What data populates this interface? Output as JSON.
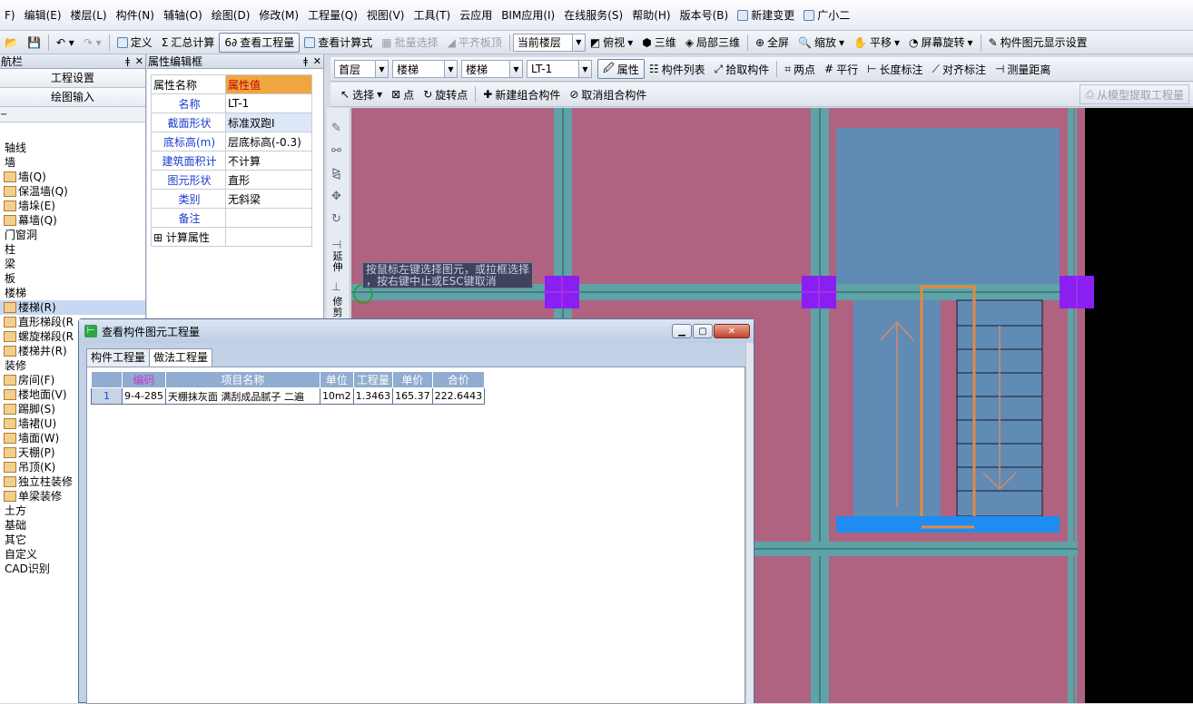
{
  "menu": [
    "F)",
    "编辑(E)",
    "楼层(L)",
    "构件(N)",
    "辅轴(O)",
    "绘图(D)",
    "修改(M)",
    "工程量(Q)",
    "视图(V)",
    "工具(T)",
    "云应用",
    "BIM应用(I)",
    "在线服务(S)",
    "帮助(H)",
    "版本号(B)",
    "新建变更",
    "广小二"
  ],
  "toolbar1": {
    "define": "定义",
    "summary": "汇总计算",
    "view_quantity": "查看工程量",
    "view_formula": "查看计算式",
    "batch_select": "批量选择",
    "align_slab": "平齐板顶",
    "floor_select": "当前楼层",
    "top_view": "俯视",
    "three_d": "三维",
    "local_3d": "局部三维",
    "fullscreen": "全屏",
    "zoom": "缩放",
    "pan": "平移",
    "rotate": "屏幕旋转",
    "display_settings": "构件图元显示设置"
  },
  "toolbar2": {
    "floor": "首层",
    "category": "楼梯",
    "type": "楼梯",
    "component": "LT-1",
    "property": "属性",
    "component_list": "构件列表",
    "pick": "拾取构件",
    "two_points": "两点",
    "parallel": "平行",
    "length_dim": "长度标注",
    "align_dim": "对齐标注",
    "measure": "测量距离"
  },
  "toolbar3": {
    "select": "选择",
    "point": "点",
    "rotate_point": "旋转点",
    "new_group": "新建组合构件",
    "cancel_group": "取消组合构件",
    "extract": "从模型提取工程量"
  },
  "left_panel": {
    "title": "航栏",
    "project_settings": "工程设置",
    "drawing_input": "绘图输入",
    "tree": [
      {
        "label": "轴线",
        "icon": false,
        "indent": 0
      },
      {
        "label": "墙",
        "icon": false,
        "indent": 0
      },
      {
        "label": "墙(Q)",
        "icon": true,
        "indent": 1
      },
      {
        "label": "保温墙(Q)",
        "icon": true,
        "indent": 1
      },
      {
        "label": "墙垛(E)",
        "icon": true,
        "indent": 1
      },
      {
        "label": "幕墙(Q)",
        "icon": true,
        "indent": 1
      },
      {
        "label": "门窗洞",
        "icon": false,
        "indent": 0
      },
      {
        "label": "柱",
        "icon": false,
        "indent": 0
      },
      {
        "label": "梁",
        "icon": false,
        "indent": 0
      },
      {
        "label": "板",
        "icon": false,
        "indent": 0
      },
      {
        "label": "楼梯",
        "icon": false,
        "indent": 0
      },
      {
        "label": "楼梯(R)",
        "icon": true,
        "indent": 1,
        "selected": true
      },
      {
        "label": "直形梯段(R",
        "icon": true,
        "indent": 1
      },
      {
        "label": "螺旋梯段(R",
        "icon": true,
        "indent": 1
      },
      {
        "label": "楼梯井(R)",
        "icon": true,
        "indent": 1
      },
      {
        "label": "装修",
        "icon": false,
        "indent": 0
      },
      {
        "label": "房间(F)",
        "icon": true,
        "indent": 1
      },
      {
        "label": "楼地面(V)",
        "icon": true,
        "indent": 1
      },
      {
        "label": "踢脚(S)",
        "icon": true,
        "indent": 1
      },
      {
        "label": "墙裙(U)",
        "icon": true,
        "indent": 1
      },
      {
        "label": "墙面(W)",
        "icon": true,
        "indent": 1
      },
      {
        "label": "天棚(P)",
        "icon": true,
        "indent": 1
      },
      {
        "label": "吊顶(K)",
        "icon": true,
        "indent": 1
      },
      {
        "label": "独立柱装修",
        "icon": true,
        "indent": 1
      },
      {
        "label": "单梁装修",
        "icon": true,
        "indent": 1
      },
      {
        "label": "土方",
        "icon": false,
        "indent": 0
      },
      {
        "label": "基础",
        "icon": false,
        "indent": 0
      },
      {
        "label": "其它",
        "icon": false,
        "indent": 0
      },
      {
        "label": "自定义",
        "icon": false,
        "indent": 0
      },
      {
        "label": "CAD识别",
        "icon": false,
        "indent": 0
      }
    ]
  },
  "property_panel": {
    "title": "属性编辑框",
    "col_name": "属性名称",
    "col_value": "属性值",
    "rows": [
      {
        "name": "名称",
        "value": "LT-1"
      },
      {
        "name": "截面形状",
        "value": "标准双跑I",
        "highlight": true
      },
      {
        "name": "底标高(m)",
        "value": "层底标高(-0.3)"
      },
      {
        "name": "建筑面积计",
        "value": "不计算"
      },
      {
        "name": "图元形状",
        "value": "直形"
      },
      {
        "name": "类别",
        "value": "无斜梁"
      },
      {
        "name": "备注",
        "value": ""
      },
      {
        "name": "计算属性",
        "value": "",
        "expander": true
      }
    ]
  },
  "vtools_labels": {
    "extend": "延伸",
    "trim": "修剪"
  },
  "tooltip": {
    "line1": "按鼠标左键选择图元，或拉框选择",
    "line2": "，按右键中止或ESC键取消"
  },
  "dialog": {
    "title": "查看构件图元工程量",
    "tabs": [
      "构件工程量",
      "做法工程量"
    ],
    "active_tab": 1,
    "columns": [
      "编码",
      "项目名称",
      "单位",
      "工程量",
      "单价",
      "合价"
    ],
    "rows": [
      {
        "index": "1",
        "code": "9-4-285",
        "name": "天棚抹灰面 满刮成品腻子 二遍",
        "unit": "10m2",
        "qty": "1.3463",
        "price": "165.37",
        "total": "222.6443"
      }
    ]
  },
  "colors": {
    "canvas": "#b06281",
    "beam": "#5fa3a6",
    "slab": "#5f8bb4",
    "column": "#8a1ff2",
    "stair_line": "#e88840",
    "landing": "#1e8cf0"
  }
}
